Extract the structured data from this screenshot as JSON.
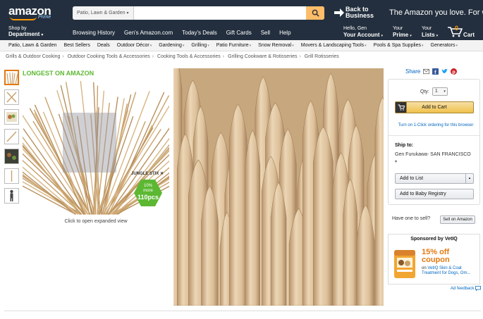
{
  "header": {
    "logo_word": "amazon",
    "logo_sub": "Prime",
    "search": {
      "scope": "Patio, Lawn & Garden",
      "value": "",
      "placeholder": ""
    },
    "promo": {
      "badge": "Back to Business",
      "tagline": "The Amazon you love. For work."
    },
    "shop_by": {
      "line1": "Shop by",
      "line2": "Department"
    },
    "nav_links": [
      "Browsing History",
      "Gen's Amazon.com",
      "Today's Deals",
      "Gift Cards",
      "Sell",
      "Help"
    ],
    "account": {
      "greeting": "Hello, Gen",
      "label": "Your Account"
    },
    "prime": {
      "line1": "Your",
      "label": "Prime"
    },
    "lists": {
      "line1": "Your",
      "label": "Lists"
    },
    "cart": {
      "count": "0",
      "label": "Cart"
    }
  },
  "subnav": {
    "title": "Patio, Lawn & Garden",
    "items": [
      "Best Sellers",
      "Deals",
      "Outdoor Décor",
      "Gardening",
      "Grilling",
      "Patio Furniture",
      "Snow Removal",
      "Movers & Landscaping Tools",
      "Pools & Spa Supplies",
      "Generators"
    ],
    "has_dropdown": [
      false,
      false,
      true,
      true,
      true,
      true,
      true,
      true,
      true,
      true
    ]
  },
  "breadcrumb": [
    "Grills & Outdoor Cooking",
    "Outdoor Cooking Tools & Accessories",
    "Cooking Tools & Accessories",
    "Grilling Cookware & Rotisseries",
    "Grill Rotisseries"
  ],
  "product": {
    "banner": "LONGEST ON AMAZON",
    "brand_mark": "JUNGLE STIX",
    "badge_line1": "10%",
    "badge_line2": "more",
    "badge_count": "110pcs",
    "click_hint": "Click to open expanded view",
    "thumbnail_count": 7,
    "selected_thumbnail": 0
  },
  "share": {
    "label": "Share"
  },
  "buybox": {
    "qty_label": "Qty:",
    "qty_value": "1",
    "add_to_cart": "Add to Cart",
    "one_click": "Turn on 1-Click ordering for this browser",
    "ship_to_label": "Ship to:",
    "ship_to_value": "Gen Furukawa- SAN FRANCISCO",
    "add_to_list": "Add to List",
    "baby_registry": "Add to Baby Registry"
  },
  "sell": {
    "question": "Have one to sell?",
    "button": "Sell on Amazon"
  },
  "sponsored": {
    "heading": "Sponsored by VetIQ",
    "offer_line1": "15% off",
    "offer_line2": "coupon",
    "desc_prefix": "on",
    "desc_link": "VetIQ Skin & Coat Treatment for Dogs, Om...",
    "ad_feedback": "Ad feedback"
  },
  "colors": {
    "nav_bg": "#232f3e",
    "accent_orange": "#f90",
    "link_blue": "#0066c0",
    "banner_green": "#5cb832",
    "cart_button": "#f0c14b"
  }
}
